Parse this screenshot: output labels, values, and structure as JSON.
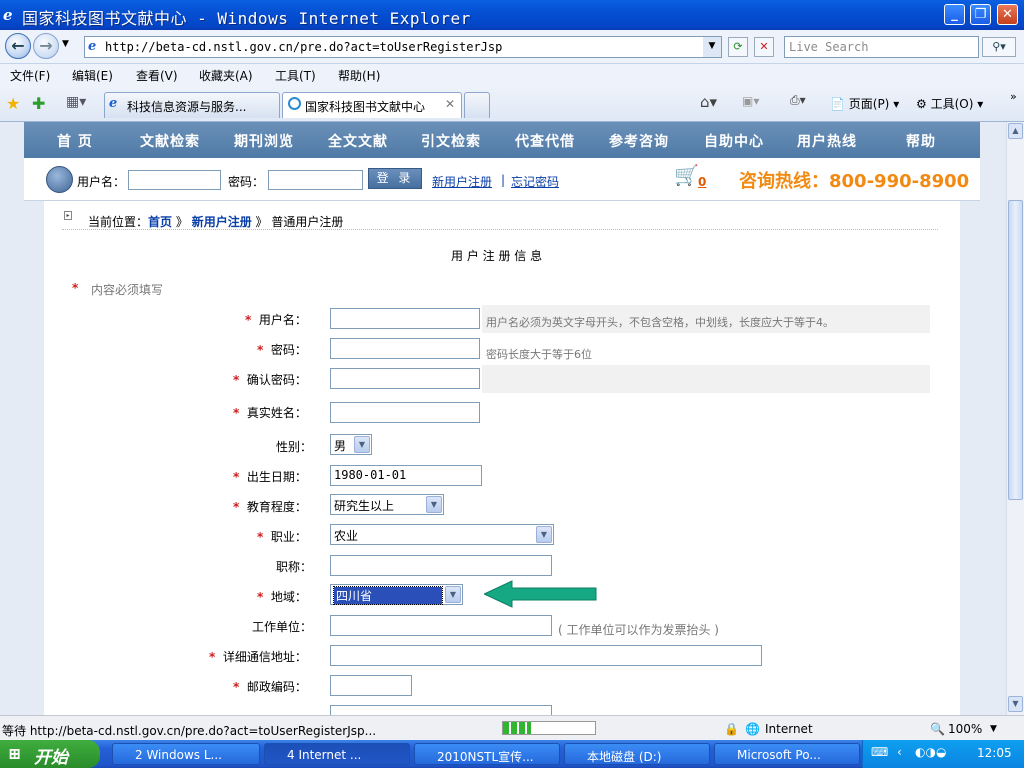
{
  "window": {
    "title": "国家科技图书文献中心 - Windows Internet Explorer"
  },
  "address": {
    "url": "http://beta-cd.nstl.gov.cn/pre.do?act=toUserRegisterJsp",
    "search_placeholder": "Live Search"
  },
  "menu": [
    "文件(F)",
    "编辑(E)",
    "查看(V)",
    "收藏夹(A)",
    "工具(T)",
    "帮助(H)"
  ],
  "tabs": [
    {
      "label": "科技信息资源与服务..."
    },
    {
      "label": "国家科技图书文献中心"
    }
  ],
  "commandbar": {
    "page": "页面(P)",
    "tools": "工具(O)"
  },
  "site": {
    "nav": [
      "首 页",
      "文献检索",
      "期刊浏览",
      "全文文献",
      "引文检索",
      "代查代借",
      "参考咨询",
      "自助中心",
      "用户热线",
      "帮助"
    ],
    "login": {
      "username_label": "用户名：",
      "password_label": "密码：",
      "login_button": "登 录",
      "register_link": "新用户注册",
      "separator": "|",
      "forgot_link": "忘记密码",
      "cart_count": "0",
      "hotline": "咨询热线：800-990-8900"
    }
  },
  "breadcrumb": {
    "prefix": "当前位置：",
    "home": "首页",
    "sep": "》",
    "register": "新用户注册",
    "current": "普通用户注册"
  },
  "form": {
    "title": "用 户 注 册 信 息",
    "required_note": "内容必须填写",
    "fields": {
      "username": {
        "label": "用户名：",
        "value": "",
        "hint": "用户名必须为英文字母开头，不包含空格，中划线，长度应大于等于4。"
      },
      "password": {
        "label": "密码：",
        "value": "",
        "hint": "密码长度大于等于6位"
      },
      "confirm": {
        "label": "确认密码：",
        "value": ""
      },
      "realname": {
        "label": "真实姓名：",
        "value": ""
      },
      "gender": {
        "label": "性别：",
        "value": "男"
      },
      "birth": {
        "label": "出生日期：",
        "value": "1980-01-01"
      },
      "education": {
        "label": "教育程度：",
        "value": "研究生以上"
      },
      "occupation": {
        "label": "职业：",
        "value": "农业"
      },
      "title": {
        "label": "职称：",
        "value": ""
      },
      "region": {
        "label": "地域：",
        "value": "四川省"
      },
      "employer": {
        "label": "工作单位：",
        "value": "",
        "hint": "( 工作单位可以作为发票抬头 )"
      },
      "address": {
        "label": "详细通信地址：",
        "value": ""
      },
      "postcode": {
        "label": "邮政编码：",
        "value": ""
      }
    }
  },
  "status": {
    "text": "等待 http://beta-cd.nstl.gov.cn/pre.do?act=toUserRegisterJsp...",
    "progress": 0.3,
    "zone": "Internet",
    "zoom": "100%"
  },
  "taskbar": {
    "start": "开始",
    "tasks": [
      "2 Windows L...",
      "4 Internet ...",
      "2010NSTL宣传...",
      "本地磁盘 (D:)",
      "Microsoft Po..."
    ],
    "clock": "12:05"
  },
  "colors": {
    "accent_nav": "#4f7aa6",
    "hotline": "#f28a12",
    "required": "#d21b1b",
    "arrow": "#16a883"
  }
}
